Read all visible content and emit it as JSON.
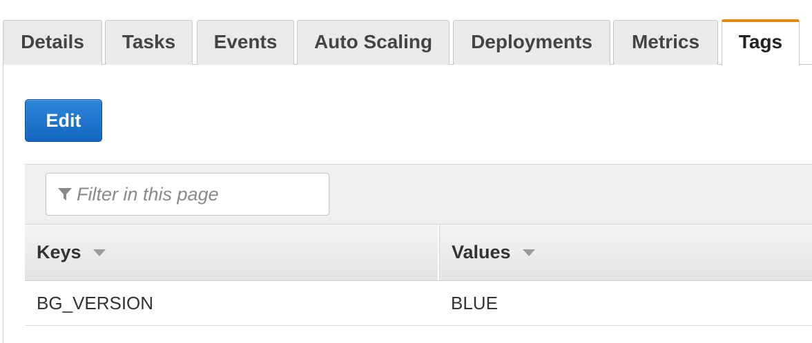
{
  "tabs": [
    {
      "label": "Details",
      "active": false
    },
    {
      "label": "Tasks",
      "active": false
    },
    {
      "label": "Events",
      "active": false
    },
    {
      "label": "Auto Scaling",
      "active": false
    },
    {
      "label": "Deployments",
      "active": false
    },
    {
      "label": "Metrics",
      "active": false
    },
    {
      "label": "Tags",
      "active": true
    }
  ],
  "toolbar": {
    "edit_label": "Edit"
  },
  "filter": {
    "placeholder": "Filter in this page",
    "icon": "filter-icon"
  },
  "table": {
    "columns": [
      "Keys",
      "Values"
    ],
    "sort_icon": "sort-down-icon",
    "rows": [
      {
        "key": "BG_VERSION",
        "value": "BLUE"
      }
    ]
  },
  "colors": {
    "active_tab_accent": "#e8870e",
    "edit_button": "#1a6fcc",
    "tab_background": "#eaeaea"
  }
}
